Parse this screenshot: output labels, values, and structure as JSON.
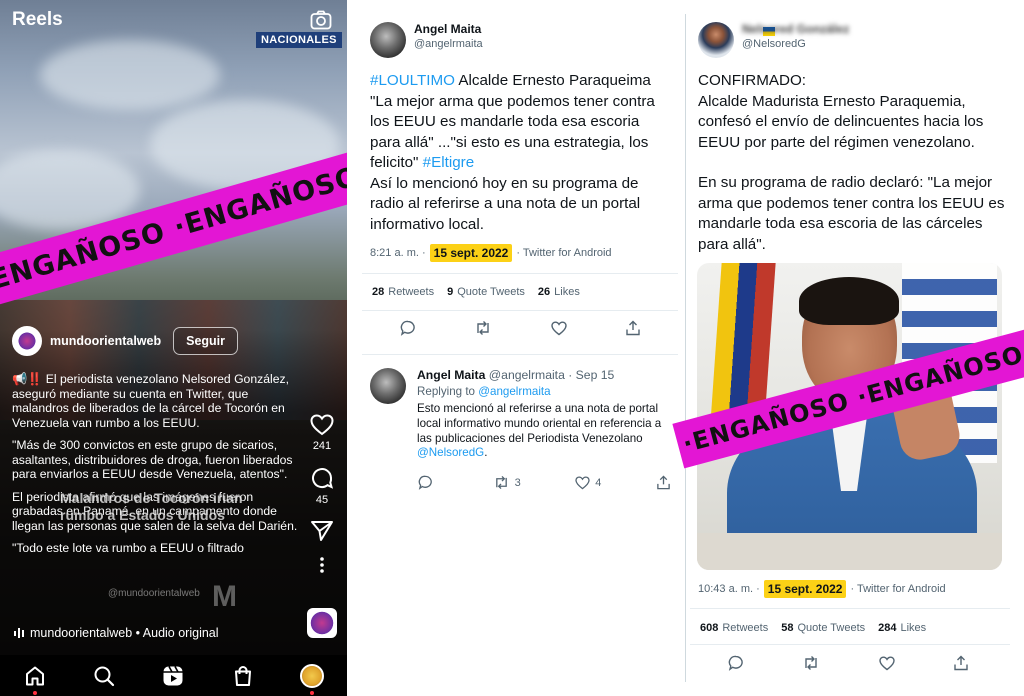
{
  "reel": {
    "title": "Reels",
    "badge": "NACIONALES",
    "profile_name": "mundoorientalweb",
    "follow_label": "Seguir",
    "caption": [
      "📢‼️ El periodista venezolano Nelsored González, aseguró mediante su cuenta en Twitter, que malandros de liberados de la cárcel de Tocorón en Venezuela van rumbo a los EEUU.",
      "\"Más de 300 convictos en este grupo de sicarios, asaltantes, distribuidores de droga, fueron liberados para enviarlos a EEUU desde Venezuela, atentos\".",
      "El periodista afirmó que las imágenes fueron grabadas en Panamá, en un campamento donde llegan las personas que salen de la selva del Darién.",
      "\"Todo este lote va rumbo a EEUU o filtrado"
    ],
    "overlay_line1": "Malandros de Tocorón irian",
    "overlay_line2": "rumbo a Estados Unidos",
    "watermark": "@mundoorientalweb",
    "likes": "241",
    "comments": "45",
    "audio": "mundoorientalweb • Audio original",
    "icons": [
      "camera-icon",
      "heart-icon",
      "comment-icon",
      "share-icon",
      "more-icon",
      "home-icon",
      "search-icon",
      "reels-icon",
      "shop-icon"
    ]
  },
  "stamp_text": "ENGAÑOSO ·ENGAÑOSO ·ENGAÑOSO ·ENGAÑOSO",
  "stamp_color": "#e316d4",
  "tweet1": {
    "name": "Angel Maita",
    "handle": "@angelrmaita",
    "hashtag1": "#LOULTIMO",
    "text1": " Alcalde Ernesto Paraqueima \"La mejor arma que podemos tener contra los EEUU es mandarle toda esa escoria para allá\" ...\"si esto es una estrategia, los felicito\" ",
    "hashtag2": "#Eltigre",
    "text2": "Así lo mencionó hoy en su programa de radio al referirse a una nota de un portal informativo local.",
    "time": "8:21 a. m. ·",
    "date": "15 sept. 2022",
    "source": "· Twitter for Android",
    "retweets": "28",
    "retweets_label": "Retweets",
    "quotes": "9",
    "quotes_label": "Quote Tweets",
    "likes": "26",
    "likes_label": "Likes"
  },
  "reply": {
    "name": "Angel Maita",
    "handle_date": "@angelrmaita · Sep 15",
    "replying_label": "Replying to ",
    "replying_handle": "@angelrmaita",
    "text": "Esto mencionó al referirse a una nota de portal local informativo mundo oriental en referencia a las publicaciones del Periodista Venezolano ",
    "mention": "@NelsoredG",
    "text_end": ".",
    "retweets": "3",
    "likes": "4"
  },
  "tweet2": {
    "name": "Nelsored González",
    "handle": "@NelsoredG",
    "flag": "🇺🇦",
    "lines": [
      "CONFIRMADO:",
      "Alcalde Madurista Ernesto Paraquemia, confesó el envío de delincuentes hacia los EEUU por parte del régimen venezolano.",
      "En su programa de radio declaró: \"La mejor arma que podemos tener contra los EEUU es mandarle toda esa escoria de las cárceles para allá\"."
    ],
    "time": "10:43 a. m. ·",
    "date": "15 sept. 2022",
    "source": "· Twitter for Android",
    "retweets": "608",
    "retweets_label": "Retweets",
    "quotes": "58",
    "quotes_label": "Quote Tweets",
    "likes": "284",
    "likes_label": "Likes"
  }
}
